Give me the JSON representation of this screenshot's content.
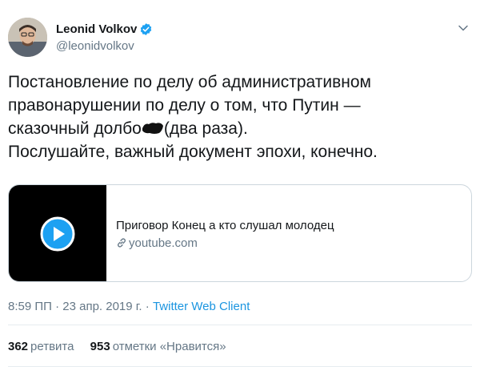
{
  "author": {
    "display_name": "Leonid Volkov",
    "handle": "@leonidvolkov"
  },
  "tweet": {
    "lines": [
      "Постановление по делу об административном",
      "правонарушении по делу о том, что Путин —",
      "сказочный долбо",
      "(два раза).",
      "Послушайте, важный документ эпохи, конечно."
    ]
  },
  "card": {
    "title": "Приговор Конец а кто слушал молодец",
    "domain": "youtube.com"
  },
  "meta": {
    "datetime": "8:59 ПП · 23 апр. 2019 г.",
    "separator": " · ",
    "client": "Twitter Web Client"
  },
  "stats": {
    "retweets": {
      "count": "362",
      "label": "ретвита"
    },
    "likes": {
      "count": "953",
      "label": "отметки «Нравится»"
    }
  },
  "colors": {
    "link": "#1b95e0",
    "secondary_text": "#657786",
    "primary_text": "#14171a",
    "play_button": "#1da1f2"
  },
  "icons": [
    "verified-badge-icon",
    "chevron-down-icon",
    "play-icon",
    "link-icon"
  ]
}
